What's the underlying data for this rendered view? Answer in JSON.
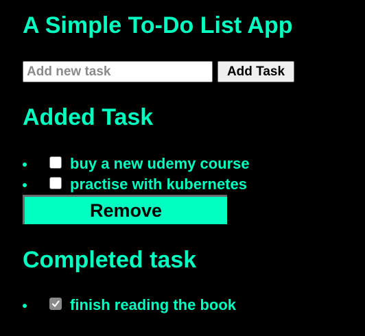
{
  "app": {
    "title": "A Simple To-Do List App"
  },
  "new_task": {
    "placeholder": "Add new task",
    "value": "",
    "add_button_label": "Add Task"
  },
  "added_section": {
    "heading": "Added Task",
    "tasks": [
      {
        "label": "buy a new udemy course",
        "checked": false
      },
      {
        "label": "practise with kubernetes",
        "checked": false
      }
    ],
    "remove_button_label": "Remove"
  },
  "completed_section": {
    "heading": "Completed task",
    "tasks": [
      {
        "label": "finish reading the book",
        "checked": true
      }
    ]
  },
  "colors": {
    "background": "#000000",
    "accent": "#00ffc0"
  }
}
